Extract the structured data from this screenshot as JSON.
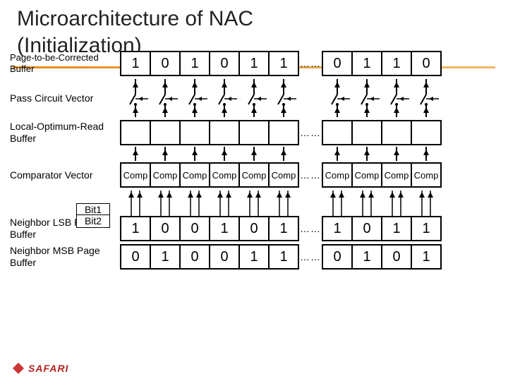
{
  "title_line1": "Microarchitecture of NAC",
  "title_line2": "(Initialization)",
  "labels": {
    "ptbc_top": "Page-to-be-Corrected",
    "ptbc_bot": "Buffer",
    "pass": "Pass Circuit Vector",
    "local_top": "Local-Optimum-Read",
    "local_bot": "Buffer",
    "comp": "Comparator Vector",
    "bit1": "Bit1",
    "bit2": "Bit2",
    "lsb_top": "Neighbor LSB Page",
    "lsb_bot": "Buffer",
    "msb_top": "Neighbor MSB Page",
    "msb_bot": "Buffer"
  },
  "dots": "……",
  "comp_label": "Comp",
  "ptbc_left": [
    "1",
    "0",
    "1",
    "0",
    "1",
    "1"
  ],
  "ptbc_right": [
    "0",
    "1",
    "1",
    "0"
  ],
  "local_left": [
    "",
    "",
    "",
    "",
    "",
    ""
  ],
  "local_right": [
    "",
    "",
    "",
    ""
  ],
  "comp_left": [
    "Comp",
    "Comp",
    "Comp",
    "Comp",
    "Comp",
    "Comp"
  ],
  "comp_right": [
    "Comp",
    "Comp",
    "Comp",
    "Comp"
  ],
  "lsb_left": [
    "1",
    "0",
    "0",
    "1",
    "0",
    "1"
  ],
  "lsb_right": [
    "1",
    "0",
    "1",
    "1"
  ],
  "msb_left": [
    "0",
    "1",
    "0",
    "0",
    "1",
    "1"
  ],
  "msb_right": [
    "0",
    "1",
    "0",
    "1"
  ],
  "logo_text": "SAFARI",
  "chart_data": {
    "type": "table",
    "title": "Microarchitecture of NAC (Initialization)",
    "rows": [
      {
        "name": "Page-to-be-Corrected Buffer",
        "left": [
          1,
          0,
          1,
          0,
          1,
          1
        ],
        "right": [
          0,
          1,
          1,
          0
        ]
      },
      {
        "name": "Pass Circuit Vector",
        "left": [
          "sw",
          "sw",
          "sw",
          "sw",
          "sw",
          "sw"
        ],
        "right": [
          "sw",
          "sw",
          "sw",
          "sw"
        ]
      },
      {
        "name": "Local-Optimum-Read Buffer",
        "left": [
          "",
          "",
          "",
          "",
          "",
          ""
        ],
        "right": [
          "",
          "",
          "",
          ""
        ]
      },
      {
        "name": "Comparator Vector",
        "left": [
          "Comp",
          "Comp",
          "Comp",
          "Comp",
          "Comp",
          "Comp"
        ],
        "right": [
          "Comp",
          "Comp",
          "Comp",
          "Comp"
        ]
      },
      {
        "name": "Neighbor LSB Page Buffer",
        "left": [
          1,
          0,
          0,
          1,
          0,
          1
        ],
        "right": [
          1,
          0,
          1,
          1
        ]
      },
      {
        "name": "Neighbor MSB Page Buffer",
        "left": [
          0,
          1,
          0,
          0,
          1,
          1
        ],
        "right": [
          0,
          1,
          0,
          1
        ]
      }
    ]
  }
}
